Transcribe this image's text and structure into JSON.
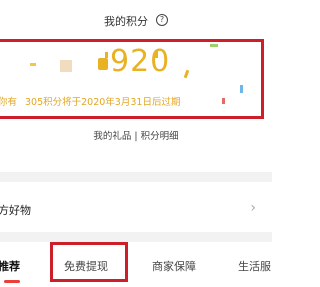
{
  "header": {
    "title": "我的积分",
    "help_icon": "question-circle-icon"
  },
  "points": {
    "value": "920",
    "expire_prefix": "你有",
    "expire_note": "305积分将于2020年3月31日后过期"
  },
  "links": {
    "text": "我的礼品 | 积分明细"
  },
  "goods": {
    "label": "方好物",
    "chevron": "›"
  },
  "tabs": [
    {
      "label": "推荐"
    },
    {
      "label": "免费提现"
    },
    {
      "label": "商家保障"
    },
    {
      "label": "生活服"
    }
  ],
  "colors": {
    "accent": "#e9b224",
    "highlight": "#cc1f2a",
    "tab_indicator": "#e9403a"
  }
}
